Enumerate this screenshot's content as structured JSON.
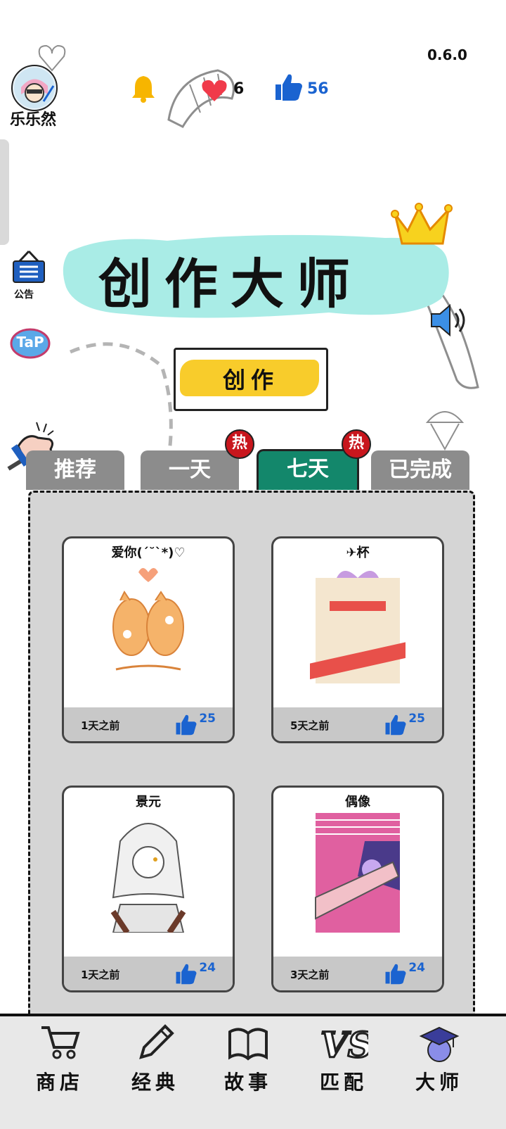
{
  "app": {
    "version": "0.6.0"
  },
  "user": {
    "name": "乐乐然"
  },
  "stats": {
    "hearts": "6",
    "likes": "56"
  },
  "side": {
    "notice_label": "公告",
    "tap_label": "TaP"
  },
  "banner": {
    "title": "创作大师"
  },
  "create_button": {
    "label": "创作"
  },
  "tabs": [
    {
      "label": "推荐",
      "hot": false,
      "active": false
    },
    {
      "label": "一天",
      "hot": true,
      "active": false
    },
    {
      "label": "七天",
      "hot": true,
      "active": true
    },
    {
      "label": "已完成",
      "hot": false,
      "active": false
    }
  ],
  "hot_badge": "热",
  "cards": [
    {
      "title": "爱你(´˘`*)♡",
      "time": "1天之前",
      "likes": "25"
    },
    {
      "title": "✈杯",
      "time": "5天之前",
      "likes": "25"
    },
    {
      "title": "景元",
      "time": "1天之前",
      "likes": "24"
    },
    {
      "title": "偶像",
      "time": "3天之前",
      "likes": "24"
    }
  ],
  "nav": [
    {
      "label": "商店",
      "icon": "cart-icon"
    },
    {
      "label": "经典",
      "icon": "pencil-icon"
    },
    {
      "label": "故事",
      "icon": "book-icon"
    },
    {
      "label": "匹配",
      "icon": "vs-icon"
    },
    {
      "label": "大师",
      "icon": "graduation-cap-icon"
    }
  ],
  "colors": {
    "active_tab": "#13876b",
    "tab": "#8c8c8c",
    "title_bg": "#a9ece6",
    "create_bg": "#f8cc2b",
    "like_blue": "#1a63d0",
    "hot_red": "#c8161d"
  }
}
